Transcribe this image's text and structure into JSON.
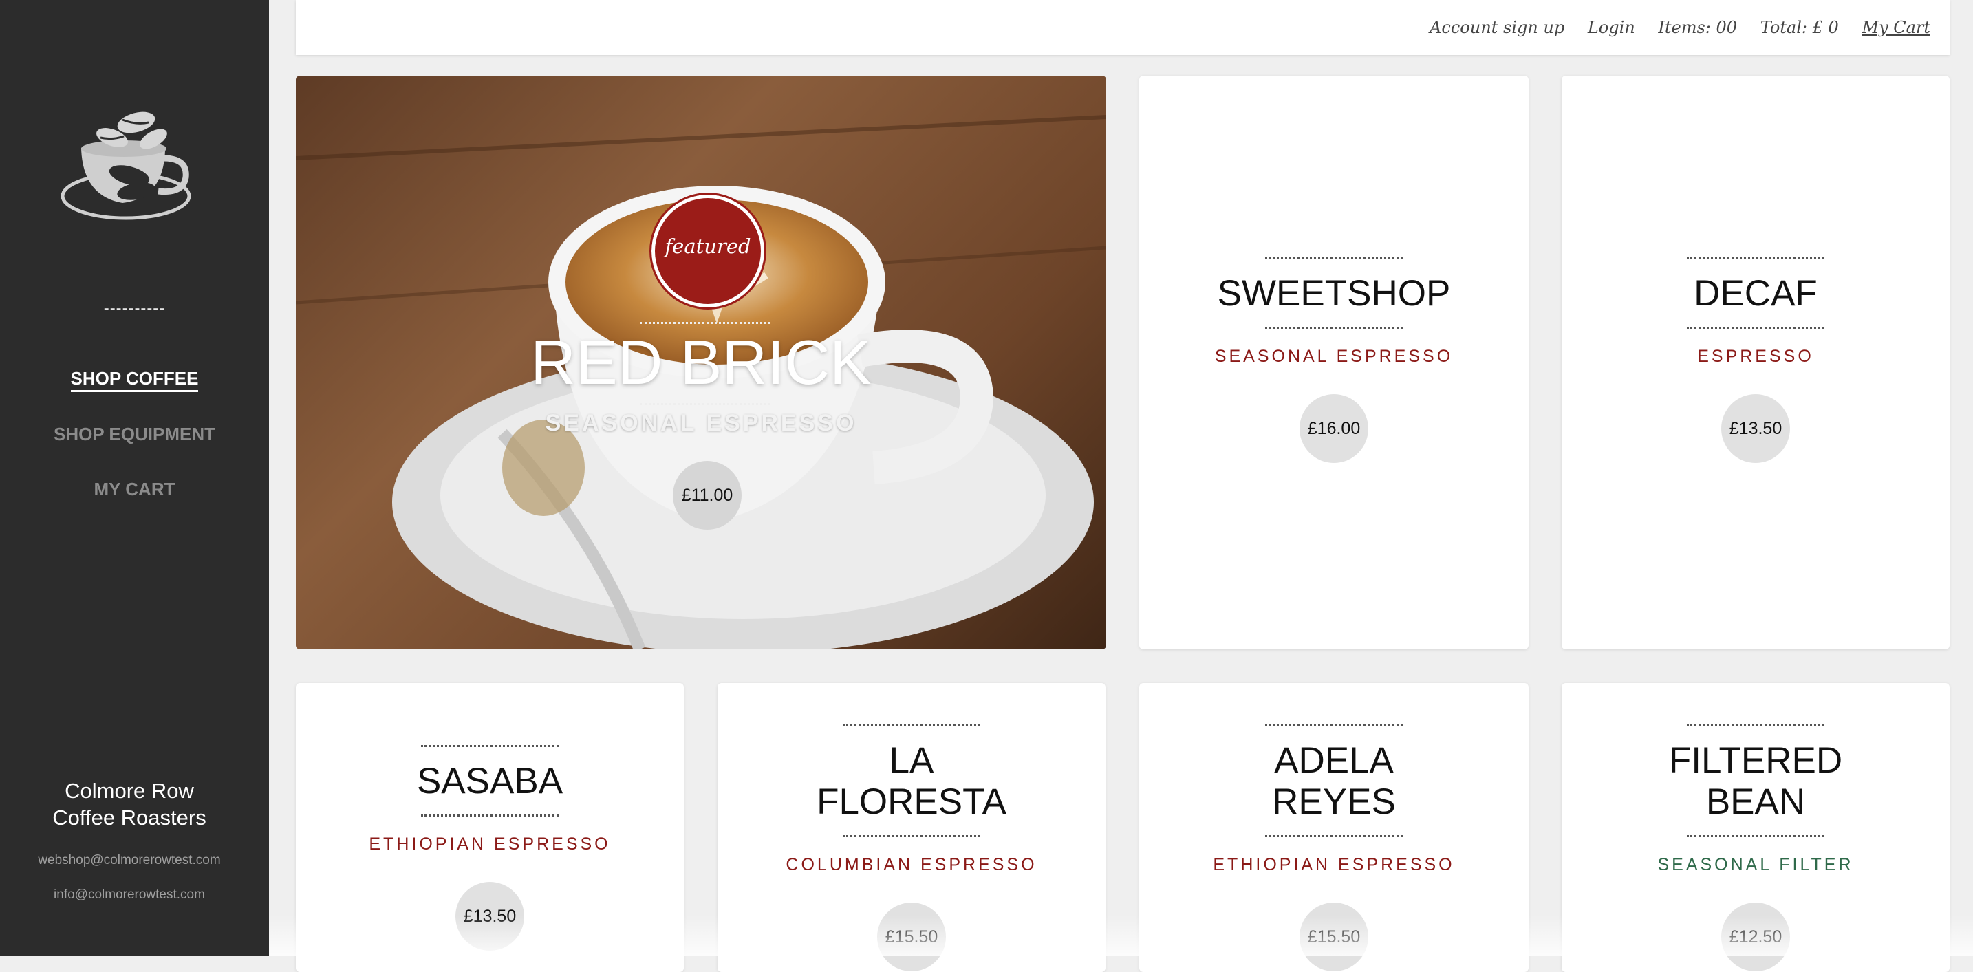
{
  "sidebar": {
    "divider": "----------",
    "nav": [
      {
        "label": "SHOP COFFEE",
        "active": true
      },
      {
        "label": "SHOP EQUIPMENT",
        "active": false
      },
      {
        "label": "MY CART",
        "active": false
      }
    ],
    "brand_line1": "Colmore Row",
    "brand_line2": "Coffee Roasters",
    "emails": [
      "webshop@colmorerowtest.com",
      "info@colmorerowtest.com"
    ]
  },
  "topbar": {
    "account_signup": "Account sign up",
    "login": "Login",
    "items": "Items: 00",
    "total": "Total: £ 0",
    "my_cart": "My Cart"
  },
  "featured": {
    "badge": "featured",
    "name": "RED BRICK",
    "subtitle": "SEASONAL ESPRESSO",
    "price": "£11.00"
  },
  "products": [
    {
      "name": "SWEETSHOP",
      "subtitle": "SEASONAL ESPRESSO",
      "price": "£16.00",
      "subtitle_color": "#8b1a17"
    },
    {
      "name": "DECAF",
      "subtitle": "ESPRESSO",
      "price": "£13.50",
      "subtitle_color": "#8b1a17"
    },
    {
      "name": "SASABA",
      "subtitle": "ETHIOPIAN ESPRESSO",
      "price": "£13.50",
      "subtitle_color": "#8b1a17"
    },
    {
      "name_line1": "LA",
      "name_line2": "FLORESTA",
      "subtitle": "COLUMBIAN ESPRESSO",
      "price": "£15.50",
      "subtitle_color": "#8b1a17"
    },
    {
      "name_line1": "ADELA",
      "name_line2": "REYES",
      "subtitle": "ETHIOPIAN ESPRESSO",
      "price": "£15.50",
      "subtitle_color": "#8b1a17"
    },
    {
      "name_line1": "FILTERED",
      "name_line2": "BEAN",
      "subtitle": "SEASONAL FILTER",
      "price": "£12.50",
      "subtitle_color": "#2f6a4a"
    }
  ],
  "colors": {
    "sidebar": "#2c2c2c",
    "accent_red": "#9b1c18",
    "accent_green": "#2f6a4a"
  },
  "icons": [
    "coffee-cup-logo-icon"
  ]
}
